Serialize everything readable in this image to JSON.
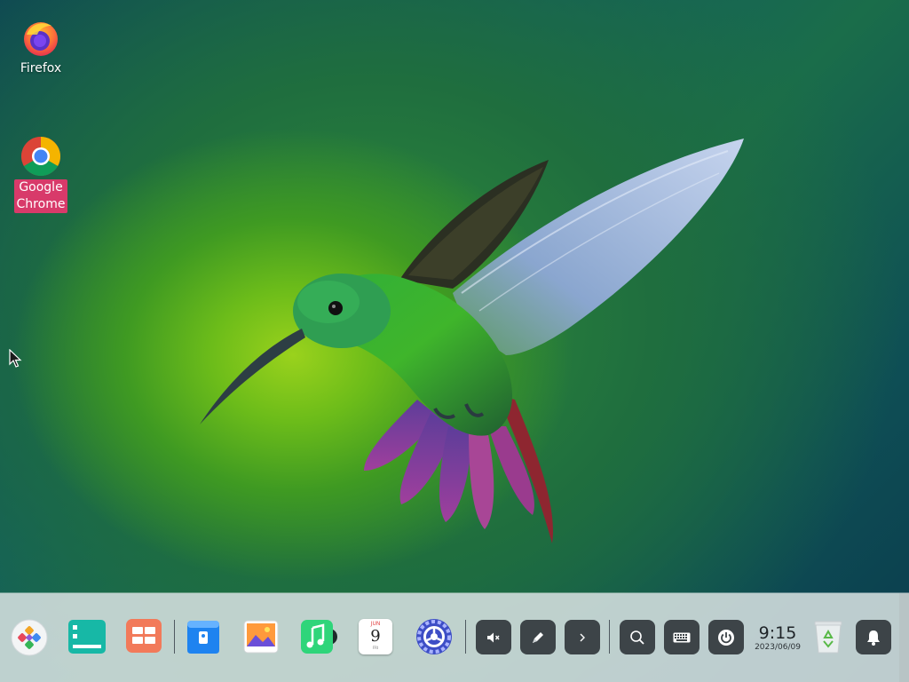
{
  "desktop": {
    "icons": [
      {
        "label": "Firefox",
        "icon": "firefox-icon",
        "selected": false
      },
      {
        "label": "Google Chrome",
        "icon": "chrome-icon",
        "selected": true
      }
    ]
  },
  "dock": {
    "apps": [
      {
        "name": "launcher",
        "icon": "launcher-icon"
      },
      {
        "name": "multitasking",
        "icon": "multitask-view-icon"
      },
      {
        "name": "workspaces",
        "icon": "workspace-grid-icon"
      },
      {
        "name": "app-store",
        "icon": "app-store-icon"
      },
      {
        "name": "image-viewer",
        "icon": "image-viewer-icon"
      },
      {
        "name": "music",
        "icon": "music-icon"
      },
      {
        "name": "calendar",
        "icon": "calendar-icon",
        "month": "JUN",
        "day": "9",
        "weekday": "FRI"
      },
      {
        "name": "control-center",
        "icon": "settings-gear-icon"
      }
    ],
    "tray": [
      {
        "name": "volume",
        "icon": "volume-muted-icon"
      },
      {
        "name": "draw",
        "icon": "pen-icon"
      },
      {
        "name": "expand",
        "icon": "chevron-right-icon"
      },
      {
        "name": "search",
        "icon": "search-icon"
      },
      {
        "name": "keyboard",
        "icon": "keyboard-icon"
      },
      {
        "name": "power",
        "icon": "power-icon"
      }
    ],
    "clock": {
      "time": "9:15",
      "date": "2023/06/09"
    },
    "trash": {
      "icon": "trash-icon"
    },
    "notifications": {
      "icon": "bell-icon"
    }
  },
  "colors": {
    "selection": "#d83a6a",
    "dock_bg": "#d6e0e0",
    "tray_button": "#3d4448"
  }
}
